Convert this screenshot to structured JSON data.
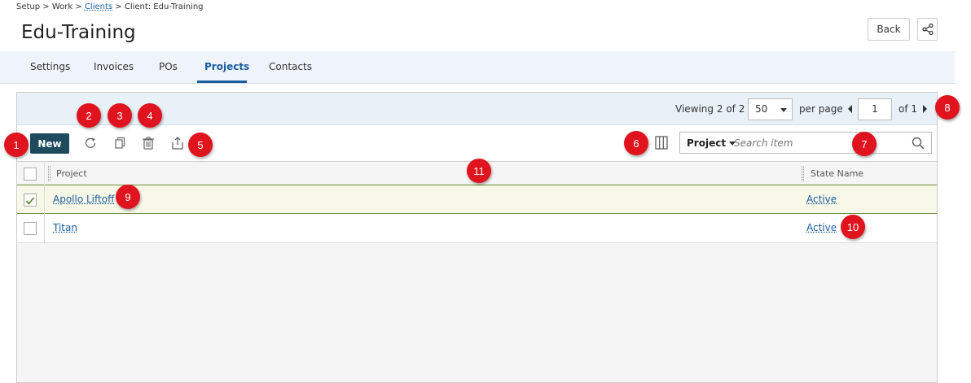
{
  "breadcrumb": {
    "setup": "Setup",
    "sep1": " > ",
    "work": "Work",
    "sep2": " > ",
    "clients": "Clients",
    "sep3": " > ",
    "current": "Client: Edu-Training"
  },
  "page_title": "Edu-Training",
  "header_buttons": {
    "back": "Back",
    "share_icon": "share-icon"
  },
  "tabs": [
    {
      "label": "Settings"
    },
    {
      "label": "Invoices"
    },
    {
      "label": "POs"
    },
    {
      "label": "Projects",
      "active": true
    },
    {
      "label": "Contacts"
    }
  ],
  "pagination": {
    "viewing_label": "Viewing",
    "viewing_count": "2 of 2",
    "per_page_value": "50",
    "per_page_label": "per page",
    "current_page": "1",
    "of_label": "of 1"
  },
  "toolbar": {
    "new_label": "New",
    "icons": [
      "refresh-icon",
      "copy-icon",
      "delete-icon",
      "export-icon",
      "columns-icon"
    ]
  },
  "search": {
    "scope": "Project",
    "placeholder": "Search item"
  },
  "grid": {
    "columns": [
      "Project",
      "State Name"
    ],
    "rows": [
      {
        "project": "Apollo Liftoff",
        "state": "Active",
        "checked": true
      },
      {
        "project": "Titan",
        "state": "Active",
        "checked": false
      }
    ]
  },
  "callouts": [
    "1",
    "2",
    "3",
    "4",
    "5",
    "6",
    "7",
    "8",
    "9",
    "10",
    "11"
  ],
  "colors": {
    "accent": "#1a5c9e",
    "new_button": "#1d4a5c",
    "callout": "#e0141e",
    "selected_row": "#f7f8e8"
  }
}
